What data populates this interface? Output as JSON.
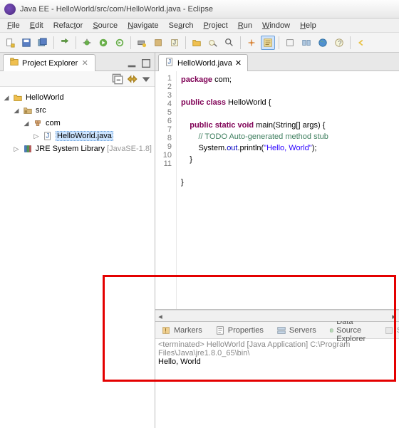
{
  "window": {
    "title": "Java EE - HelloWorld/src/com/HelloWorld.java - Eclipse"
  },
  "menu": [
    "File",
    "Edit",
    "Refactor",
    "Source",
    "Navigate",
    "Search",
    "Project",
    "Run",
    "Window",
    "Help"
  ],
  "projectExplorer": {
    "title": "Project Explorer",
    "nodes": {
      "project": "HelloWorld",
      "src": "src",
      "pkg": "com",
      "file": "HelloWorld.java",
      "library": "JRE System Library",
      "librarySuffix": "[JavaSE-1.8]"
    }
  },
  "editor": {
    "tab": "HelloWorld.java",
    "lines": [
      "1",
      "2",
      "3",
      "4",
      "5",
      "6",
      "7",
      "8",
      "9",
      "10",
      "11"
    ]
  },
  "code": {
    "l1a": "package",
    "l1b": " com;",
    "l3a": "public",
    "l3b": " ",
    "l3c": "class",
    "l3d": " HelloWorld {",
    "l5a": "    ",
    "l5b": "public",
    "l5c": " ",
    "l5d": "static",
    "l5e": " ",
    "l5f": "void",
    "l5g": " main(String[] args) {",
    "l6a": "        ",
    "l6b": "// TODO Auto-generated method stub",
    "l7a": "        System.",
    "l7b": "out",
    "l7c": ".println(",
    "l7d": "\"Hello, World\"",
    "l7e": ");",
    "l8": "    }",
    "l10": "}"
  },
  "bottomTabs": {
    "markers": "Markers",
    "properties": "Properties",
    "servers": "Servers",
    "dataSource": "Data Source Explorer",
    "snippets": "Snippets"
  },
  "console": {
    "meta": "<terminated> HelloWorld [Java Application] C:\\Program Files\\Java\\jre1.8.0_65\\bin\\",
    "output": "Hello, World"
  }
}
